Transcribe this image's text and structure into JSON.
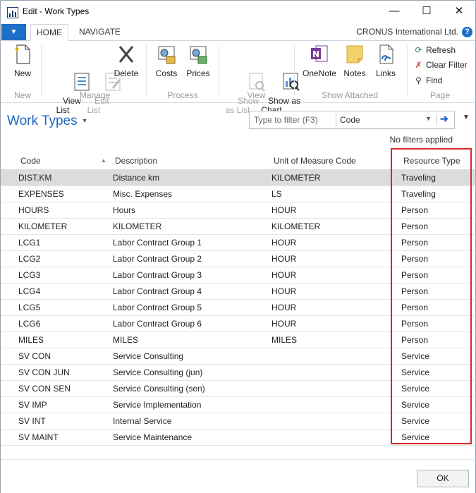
{
  "window": {
    "title": "Edit - Work Types",
    "minimize_glyph": "—",
    "maximize_glyph": "☐",
    "close_glyph": "✕"
  },
  "ribbon_tabs": {
    "menu_glyph": "▼",
    "home": "HOME",
    "navigate": "NAVIGATE",
    "company": "CRONUS International Ltd.",
    "help_glyph": "?"
  },
  "ribbon": {
    "new_label": "New",
    "view_list_label": "View\nList",
    "edit_list_label": "Edit\nList",
    "delete_label": "Delete",
    "costs_label": "Costs",
    "prices_label": "Prices",
    "show_as_list_label": "Show\nas List",
    "show_as_chart_label": "Show as\nChart",
    "onenote_label": "OneNote",
    "notes_label": "Notes",
    "links_label": "Links",
    "refresh_label": "Refresh",
    "clear_filter_label": "Clear Filter",
    "find_label": "Find",
    "groups": {
      "new": "New",
      "manage": "Manage",
      "process": "Process",
      "view": "View",
      "show_attached": "Show Attached",
      "page": "Page"
    }
  },
  "page": {
    "title": "Work Types",
    "title_caret": "▼",
    "filter_placeholder": "Type to filter (F3)",
    "filter_field": "Code",
    "filter_dd_glyph": "▼",
    "filter_go_glyph": "➔",
    "collapse_glyph": "▼",
    "no_filters": "No filters applied"
  },
  "grid": {
    "columns": [
      "Code",
      "Description",
      "Unit of Measure Code",
      "Resource Type"
    ],
    "sort_glyph": "▲",
    "rows": [
      [
        "DIST.KM",
        "Distance km",
        "KILOMETER",
        "Traveling"
      ],
      [
        "EXPENSES",
        "Misc. Expenses",
        "LS",
        "Traveling"
      ],
      [
        "HOURS",
        "Hours",
        "HOUR",
        "Person"
      ],
      [
        "KILOMETER",
        "KILOMETER",
        "KILOMETER",
        "Person"
      ],
      [
        "LCG1",
        "Labor Contract Group 1",
        "HOUR",
        "Person"
      ],
      [
        "LCG2",
        "Labor Contract Group 2",
        "HOUR",
        "Person"
      ],
      [
        "LCG3",
        "Labor Contract Group 3",
        "HOUR",
        "Person"
      ],
      [
        "LCG4",
        "Labor Contract Group 4",
        "HOUR",
        "Person"
      ],
      [
        "LCG5",
        "Labor Contract Group 5",
        "HOUR",
        "Person"
      ],
      [
        "LCG6",
        "Labor Contract Group 6",
        "HOUR",
        "Person"
      ],
      [
        "MILES",
        "MILES",
        "MILES",
        "Person"
      ],
      [
        "SV CON",
        "Service Consulting",
        "",
        "Service"
      ],
      [
        "SV CON JUN",
        "Service Consulting (jun)",
        "",
        "Service"
      ],
      [
        "SV CON SEN",
        "Service Consulting (sen)",
        "",
        "Service"
      ],
      [
        "SV IMP",
        "Service Implementation",
        "",
        "Service"
      ],
      [
        "SV INT",
        "Internal Service",
        "",
        "Service"
      ],
      [
        "SV MAINT",
        "Service Maintenance",
        "",
        "Service"
      ]
    ]
  },
  "footer": {
    "ok_label": "OK"
  },
  "colors": {
    "accent": "#1e6fc8",
    "title_blue": "#1f66c2",
    "highlight_red": "#d9262c",
    "selected_row": "#dcdcdc"
  }
}
